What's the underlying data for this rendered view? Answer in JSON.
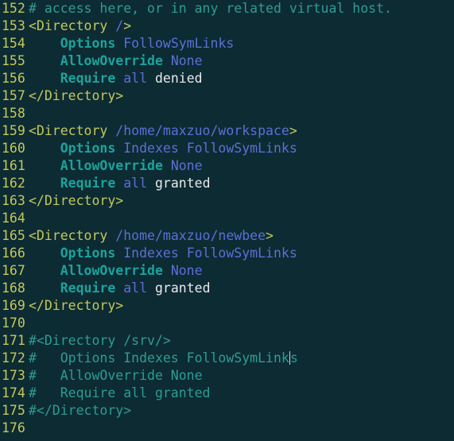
{
  "editor": {
    "type": "terminal-text-editor",
    "file_syntax": "apache-config",
    "background_color": "#0d2b33",
    "colors": {
      "line_number": "#c3c95a",
      "comment": "#2e9c94",
      "tag": "#c3c95a",
      "directive": "#1ba39c",
      "value": "#5c6fd6",
      "plain_text": "#e8eaea",
      "cursor": "#cfd6d6"
    },
    "first_line_number": 152,
    "last_line_number": 176,
    "cursor": {
      "line": 172,
      "after_text": "FollowSymLink",
      "before_text": "s"
    },
    "lines": [
      {
        "number": "152",
        "tokens": [
          {
            "t": "# access here, or in any related virtual host.",
            "c": "comment"
          }
        ]
      },
      {
        "number": "153",
        "tokens": [
          {
            "t": "<Directory ",
            "c": "tag"
          },
          {
            "t": "/",
            "c": "path"
          },
          {
            "t": ">",
            "c": "tag"
          }
        ]
      },
      {
        "number": "154",
        "tokens": [
          {
            "t": "    Options ",
            "c": "directive"
          },
          {
            "t": "FollowSymLinks",
            "c": "value"
          }
        ]
      },
      {
        "number": "155",
        "tokens": [
          {
            "t": "    AllowOverride ",
            "c": "directive"
          },
          {
            "t": "None",
            "c": "value"
          }
        ]
      },
      {
        "number": "156",
        "tokens": [
          {
            "t": "    Require ",
            "c": "directive"
          },
          {
            "t": "all ",
            "c": "value"
          },
          {
            "t": "denied",
            "c": "plain"
          }
        ]
      },
      {
        "number": "157",
        "tokens": [
          {
            "t": "</Directory>",
            "c": "tag"
          }
        ]
      },
      {
        "number": "158",
        "tokens": []
      },
      {
        "number": "159",
        "tokens": [
          {
            "t": "<Directory ",
            "c": "tag"
          },
          {
            "t": "/home/maxzuo/workspace",
            "c": "path"
          },
          {
            "t": ">",
            "c": "tag"
          }
        ]
      },
      {
        "number": "160",
        "tokens": [
          {
            "t": "    Options ",
            "c": "directive"
          },
          {
            "t": "Indexes FollowSymLinks",
            "c": "value"
          }
        ]
      },
      {
        "number": "161",
        "tokens": [
          {
            "t": "    AllowOverride ",
            "c": "directive"
          },
          {
            "t": "None",
            "c": "value"
          }
        ]
      },
      {
        "number": "162",
        "tokens": [
          {
            "t": "    Require ",
            "c": "directive"
          },
          {
            "t": "all ",
            "c": "value"
          },
          {
            "t": "granted",
            "c": "plain"
          }
        ]
      },
      {
        "number": "163",
        "tokens": [
          {
            "t": "</Directory>",
            "c": "tag"
          }
        ]
      },
      {
        "number": "164",
        "tokens": []
      },
      {
        "number": "165",
        "tokens": [
          {
            "t": "<Directory ",
            "c": "tag"
          },
          {
            "t": "/home/maxzuo/newbee",
            "c": "path"
          },
          {
            "t": ">",
            "c": "tag"
          }
        ]
      },
      {
        "number": "166",
        "tokens": [
          {
            "t": "    Options ",
            "c": "directive"
          },
          {
            "t": "Indexes FollowSymLinks",
            "c": "value"
          }
        ]
      },
      {
        "number": "167",
        "tokens": [
          {
            "t": "    AllowOverride ",
            "c": "directive"
          },
          {
            "t": "None",
            "c": "value"
          }
        ]
      },
      {
        "number": "168",
        "tokens": [
          {
            "t": "    Require ",
            "c": "directive"
          },
          {
            "t": "all ",
            "c": "value"
          },
          {
            "t": "granted",
            "c": "plain"
          }
        ]
      },
      {
        "number": "169",
        "tokens": [
          {
            "t": "</Directory>",
            "c": "tag"
          }
        ]
      },
      {
        "number": "170",
        "tokens": []
      },
      {
        "number": "171",
        "tokens": [
          {
            "t": "#<Directory /srv/>",
            "c": "comment"
          }
        ]
      },
      {
        "number": "172",
        "tokens": [
          {
            "t": "#   Options Indexes FollowSymLink",
            "c": "comment"
          },
          {
            "cursor": true
          },
          {
            "t": "s",
            "c": "comment"
          }
        ]
      },
      {
        "number": "173",
        "tokens": [
          {
            "t": "#   AllowOverride None",
            "c": "comment"
          }
        ]
      },
      {
        "number": "174",
        "tokens": [
          {
            "t": "#   Require all granted",
            "c": "comment"
          }
        ]
      },
      {
        "number": "175",
        "tokens": [
          {
            "t": "#</Directory>",
            "c": "comment"
          }
        ]
      },
      {
        "number": "176",
        "tokens": []
      }
    ]
  }
}
